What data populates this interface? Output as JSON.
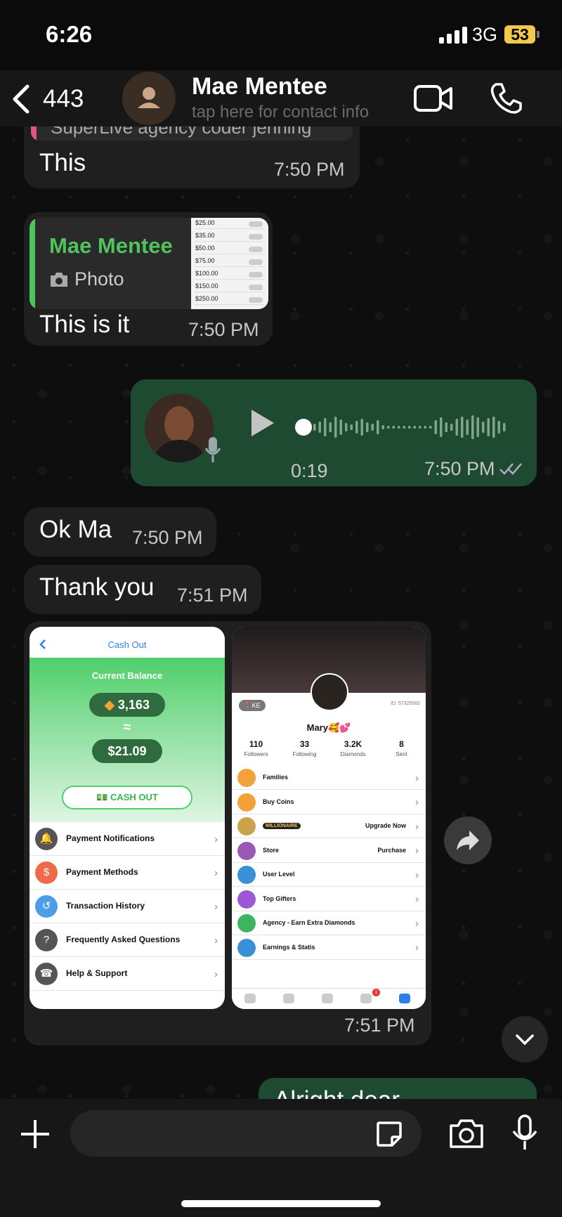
{
  "status_bar": {
    "time": "6:26",
    "network": "3G",
    "battery": "53"
  },
  "header": {
    "back_count": "443",
    "contact_name": "Mae Mentee",
    "contact_subtitle": "tap here for contact info"
  },
  "messages": {
    "m1": {
      "partial": "SuperLive agency coder jenning",
      "text": "This",
      "time": "7:50 PM"
    },
    "m2": {
      "quote_author": "Mae Mentee",
      "quote_type": "Photo",
      "text": "This is it",
      "time": "7:50 PM",
      "thumb_rows": [
        "$25.00",
        "$35.00",
        "$50.00",
        "$75.00",
        "$100.00",
        "$150.00",
        "$250.00"
      ]
    },
    "m3": {
      "duration": "0:19",
      "time": "7:50 PM"
    },
    "m4": {
      "text": "Ok Ma",
      "time": "7:50 PM"
    },
    "m5": {
      "text": "Thank you",
      "time": "7:51 PM"
    },
    "m6": {
      "time": "7:51 PM"
    },
    "m7": {
      "text": "Alright dear"
    }
  },
  "cashout": {
    "title": "Cash Out",
    "balance_label": "Current Balance",
    "diamonds": "3,163",
    "approx": "≈",
    "usd": "$21.09",
    "button": "CASH OUT",
    "menu": [
      "Payment Notifications",
      "Payment Methods",
      "Transaction History",
      "Frequently Asked Questions",
      "Help & Support"
    ]
  },
  "profile": {
    "country": "KE",
    "id": "ID: 57325582",
    "name": "Mary🥰💕",
    "stats": [
      {
        "value": "110",
        "label": "Followers"
      },
      {
        "value": "33",
        "label": "Following"
      },
      {
        "value": "3.2K",
        "label": "Diamonds"
      },
      {
        "value": "8",
        "label": "Sent"
      }
    ],
    "menu": [
      {
        "label": "Families",
        "right": ""
      },
      {
        "label": "Buy Coins",
        "right": ""
      },
      {
        "label": "MILLIONAIRE",
        "right": "Upgrade Now"
      },
      {
        "label": "Store",
        "right": "Purchase"
      },
      {
        "label": "User Level",
        "right": ""
      },
      {
        "label": "Top Gifters",
        "right": ""
      },
      {
        "label": "Agency - Earn Extra Diamonds",
        "right": ""
      },
      {
        "label": "Earnings & Statis",
        "right": ""
      }
    ],
    "nav_badge": "1"
  },
  "colors": {
    "outgoing": "#1f4a32",
    "incoming": "#1f1f1f",
    "accent_green": "#4fc35c",
    "cash_green": "#5ad36e",
    "link_blue": "#2f7ee8"
  }
}
